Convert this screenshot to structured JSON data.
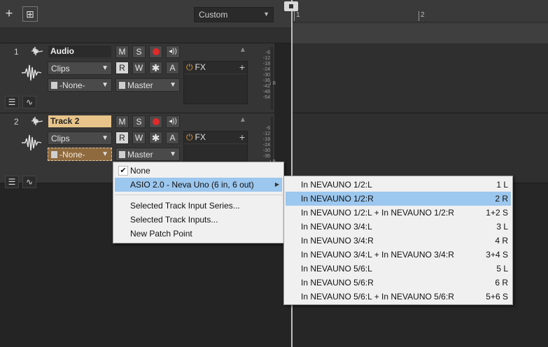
{
  "toolbar": {
    "add_track": "+",
    "add_folder": "⊞",
    "preset": "Custom",
    "preset_arrow": "▼"
  },
  "ruler": {
    "marks": [
      "1",
      "2"
    ]
  },
  "tracks": [
    {
      "number": "1",
      "name": "Audio",
      "mute": "M",
      "solo": "S",
      "read": "R",
      "write": "W",
      "snap": "✱",
      "auto": "A",
      "clips": "Clips",
      "input": "-None-",
      "output": "Master",
      "fx": "FX",
      "fx_add": "+",
      "meter_labels": [
        "-6",
        "-12",
        "-18",
        "-24",
        "-30",
        "-36",
        "-42",
        "-48",
        "-54"
      ],
      "meter_db": "dB"
    },
    {
      "number": "2",
      "name": "Track 2",
      "mute": "M",
      "solo": "S",
      "read": "R",
      "write": "W",
      "snap": "✱",
      "auto": "A",
      "clips": "Clips",
      "input": "-None-",
      "output": "Master",
      "fx": "FX",
      "fx_add": "+",
      "meter_labels": [
        "-6",
        "-12",
        "-18",
        "-24",
        "-30",
        "-36"
      ],
      "meter_db": "dB"
    }
  ],
  "input_menu": {
    "none": "None",
    "none_check": "✔",
    "asio": "ASIO 2.0 - Neva Uno (6 in, 6 out)",
    "asio_arrow": "▶",
    "series": "Selected Track Input Series...",
    "inputs": "Selected Track Inputs...",
    "patch": "New Patch Point"
  },
  "submenu": {
    "items": [
      {
        "label": "In NEVAUNO  1/2:L",
        "short": "1 L",
        "selected": false
      },
      {
        "label": "In NEVAUNO  1/2:R",
        "short": "2 R",
        "selected": true
      },
      {
        "label": "In NEVAUNO  1/2:L + In NEVAUNO  1/2:R",
        "short": "1+2 S",
        "selected": false
      },
      {
        "label": "In NEVAUNO  3/4:L",
        "short": "3 L",
        "selected": false
      },
      {
        "label": "In NEVAUNO  3/4:R",
        "short": "4 R",
        "selected": false
      },
      {
        "label": "In NEVAUNO  3/4:L + In NEVAUNO  3/4:R",
        "short": "3+4 S",
        "selected": false
      },
      {
        "label": "In NEVAUNO  5/6:L",
        "short": "5 L",
        "selected": false
      },
      {
        "label": "In NEVAUNO  5/6:R",
        "short": "6 R",
        "selected": false
      },
      {
        "label": "In NEVAUNO  5/6:L + In NEVAUNO  5/6:R",
        "short": "5+6 S",
        "selected": false
      }
    ]
  },
  "colors": {
    "selected_track_name": "#e8c48a",
    "active_input": "#8f6a3f",
    "menu_highlight": "#9cc7ee",
    "record": "#e02a2a",
    "fx_power": "#e79a3a"
  }
}
